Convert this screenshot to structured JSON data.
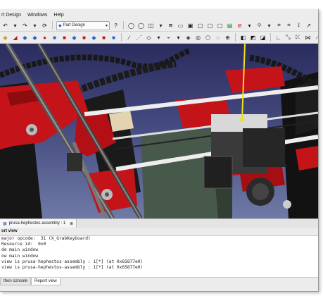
{
  "menubar": {
    "items": [
      "rt Design",
      "Windows",
      "Help"
    ]
  },
  "workbench": {
    "label": "Part Design"
  },
  "document_tab": {
    "label": "prusa-hephestos-assembly : 1"
  },
  "panel": {
    "title": "ort view"
  },
  "report_lines": [
    "major opcode:  31 (X_GrabKeyboard)",
    "Resource id:  0x0",
    "de main window",
    "ow main window",
    "",
    "view is prusa-hephestos-assembly : 1[*] (at 0x65877e0)",
    "view is prusa-hephestos-assembly : 1[*] (at 0x65877e0)",
    "view is prusa-hephestos-assembly : 1[*] (at 0x65877e0)"
  ],
  "bottom_tabs": [
    "thon console",
    "Report view"
  ],
  "colors": {
    "printer_frame": "#c4141a",
    "viewport_top": "#2b2c5e",
    "viewport_bottom": "#6f7aa6"
  }
}
